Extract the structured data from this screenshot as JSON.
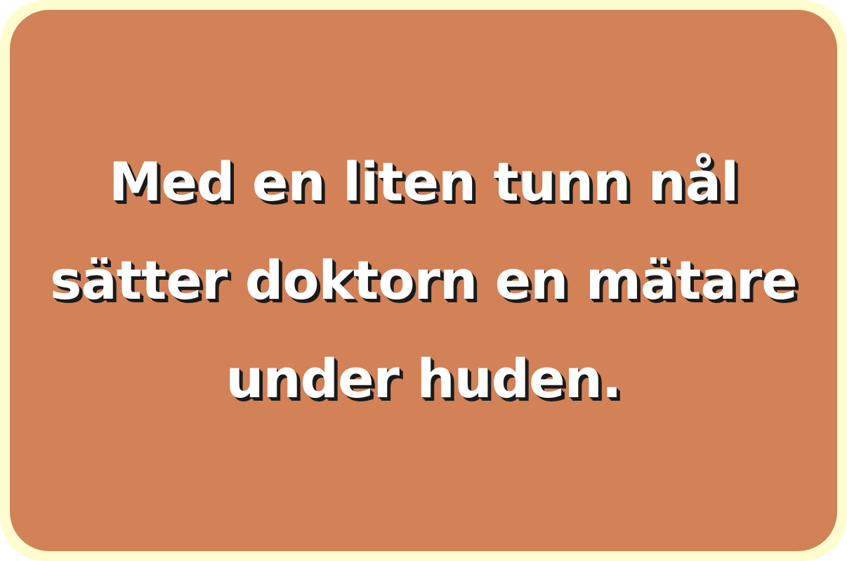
{
  "card": {
    "lines": [
      "Med en liten tunn nål",
      "sätter doktorn en mätare",
      "under huden."
    ]
  },
  "colors": {
    "frame": "#fffccf",
    "card": "#d38157",
    "text": "#ffffff",
    "text_shadow": "#1a1a1a"
  }
}
